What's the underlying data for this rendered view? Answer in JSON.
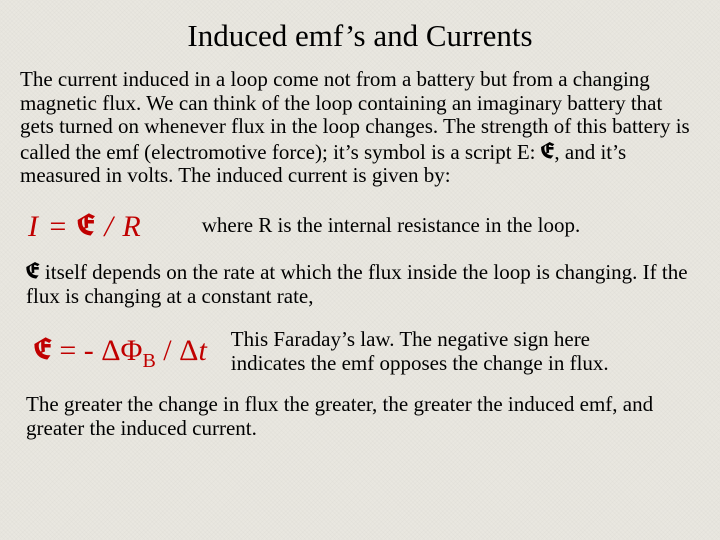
{
  "title": "Induced emf’s and Currents",
  "intro_html": "The current induced in a loop come not from a battery but from a changing magnetic flux. We can think of the loop containing an imaginary battery that gets turned on whenever flux in the loop changes. The strength of this battery is called the emf (electromotive force); it’s symbol is a script E: <span class=\"emf-inline\">E</span>, and it’s measured in volts. The induced current is given by:",
  "formula1_html": "I = <span class=\"emf\">E</span> / R",
  "where_text": "where  R  is the internal resistance in the loop.",
  "para2_html": "<span class=\"emf-inline\">E</span>  itself depends on the rate at which the flux inside the loop is changing. If the flux is changing at a constant rate,",
  "formula2_html": "<span class=\"emf\">E</span> = - ΔΦ<sub>B</sub> / Δ<span class=\"it\">t</span>",
  "faraday_text": "This Faraday’s law. The negative sign here indicates the emf opposes the change in flux.",
  "conclusion": "The greater the change in flux the greater, the greater the induced emf, and greater the induced current."
}
